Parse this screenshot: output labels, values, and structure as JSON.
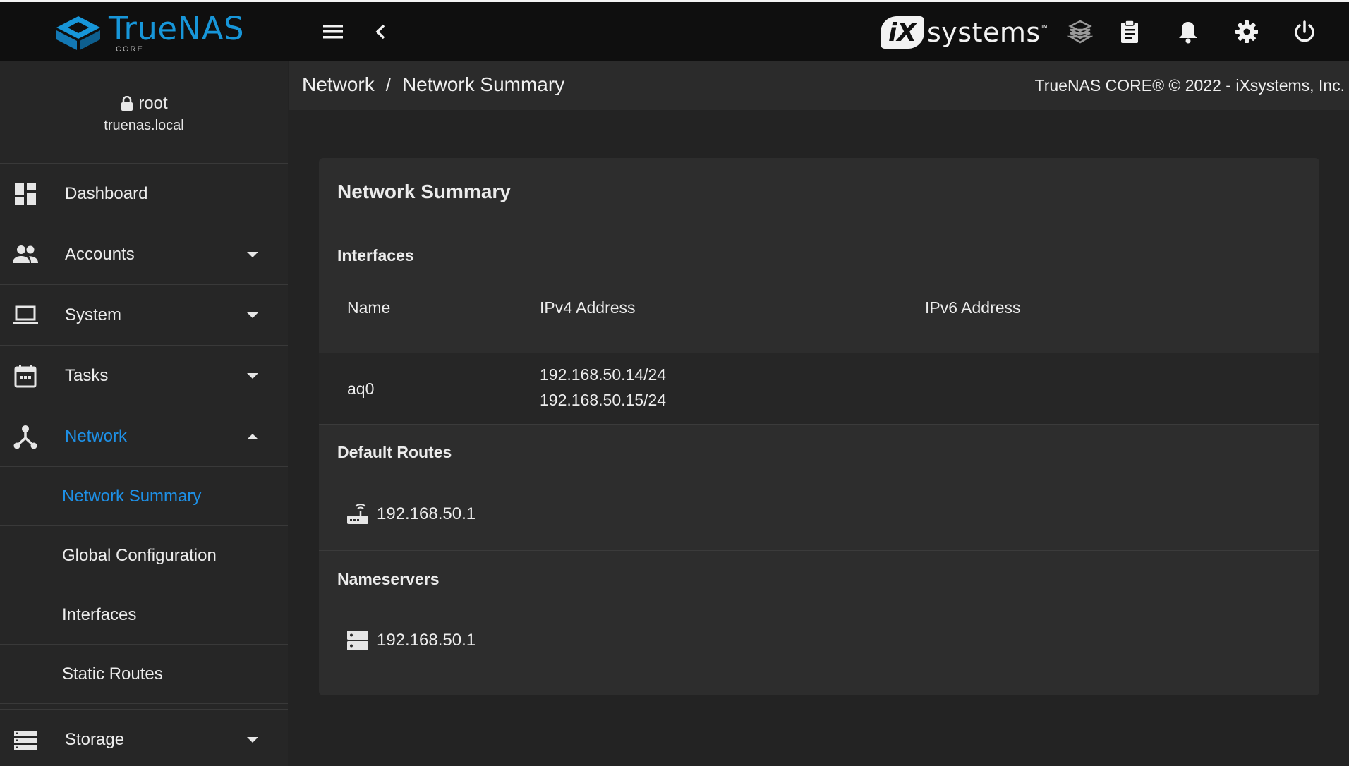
{
  "header": {
    "logo_word": "TrueNAS",
    "logo_sub": "CORE",
    "vendor_logo_badge": "iX",
    "vendor_logo_text": "systems",
    "vendor_logo_tm": "™",
    "icons": [
      "menu-icon",
      "chevron-left-icon",
      "truecommand-icon",
      "clipboard-icon",
      "bell-icon",
      "gear-icon",
      "power-icon"
    ]
  },
  "user": {
    "name": "root",
    "host": "truenas.local"
  },
  "sidebar": {
    "items": [
      {
        "label": "Dashboard",
        "icon": "dashboard-icon"
      },
      {
        "label": "Accounts",
        "icon": "people-icon"
      },
      {
        "label": "System",
        "icon": "laptop-icon"
      },
      {
        "label": "Tasks",
        "icon": "calendar-icon"
      },
      {
        "label": "Network",
        "icon": "network-icon"
      }
    ],
    "network_sub": [
      {
        "label": "Network Summary"
      },
      {
        "label": "Global Configuration"
      },
      {
        "label": "Interfaces"
      },
      {
        "label": "Static Routes"
      }
    ],
    "storage": {
      "label": "Storage",
      "icon": "storage-icon"
    }
  },
  "breadcrumb": {
    "parent": "Network",
    "separator": "/",
    "current": "Network Summary"
  },
  "copyright": "TrueNAS CORE® © 2022 - iXsystems, Inc.",
  "card": {
    "title": "Network Summary",
    "interfaces": {
      "title": "Interfaces",
      "columns": [
        "Name",
        "IPv4 Address",
        "IPv6 Address"
      ],
      "rows": [
        {
          "name": "aq0",
          "ipv4": [
            "192.168.50.14/24",
            "192.168.50.15/24"
          ],
          "ipv6": ""
        }
      ]
    },
    "default_routes": {
      "title": "Default Routes",
      "items": [
        "192.168.50.1"
      ]
    },
    "nameservers": {
      "title": "Nameservers",
      "items": [
        "192.168.50.1"
      ]
    }
  },
  "colors": {
    "accent": "#1e90e6",
    "topbar": "#0f0f0f",
    "sidebar": "#262626",
    "card": "#2d2d2d"
  }
}
